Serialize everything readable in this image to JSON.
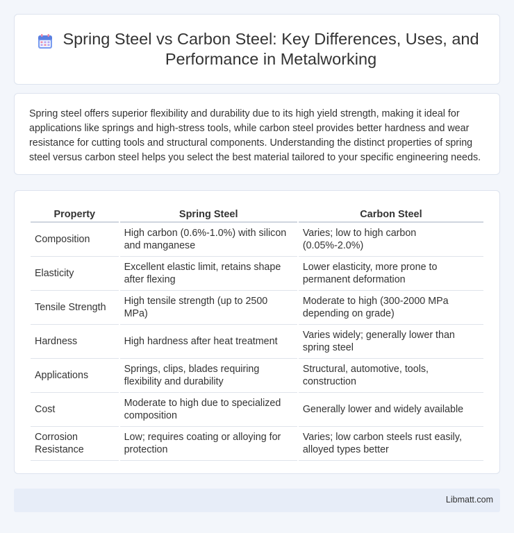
{
  "header": {
    "title": "Spring Steel vs Carbon Steel: Key Differences, Uses, and Performance in Metalworking",
    "icon": "calendar-icon"
  },
  "intro": {
    "text": "Spring steel offers superior flexibility and durability due to its high yield strength, making it ideal for applications like springs and high-stress tools, while carbon steel provides better hardness and wear resistance for cutting tools and structural components. Understanding the distinct properties of spring steel versus carbon steel helps you select the best material tailored to your specific engineering needs."
  },
  "table": {
    "headers": [
      "Property",
      "Spring Steel",
      "Carbon Steel"
    ],
    "rows": [
      [
        "Composition",
        "High carbon (0.6%-1.0%) with silicon and manganese",
        "Varies; low to high carbon (0.05%-2.0%)"
      ],
      [
        "Elasticity",
        "Excellent elastic limit, retains shape after flexing",
        "Lower elasticity, more prone to permanent deformation"
      ],
      [
        "Tensile Strength",
        "High tensile strength (up to 2500 MPa)",
        "Moderate to high (300-2000 MPa depending on grade)"
      ],
      [
        "Hardness",
        "High hardness after heat treatment",
        "Varies widely; generally lower than spring steel"
      ],
      [
        "Applications",
        "Springs, clips, blades requiring flexibility and durability",
        "Structural, automotive, tools, construction"
      ],
      [
        "Cost",
        "Moderate to high due to specialized composition",
        "Generally lower and widely available"
      ],
      [
        "Corrosion Resistance",
        "Low; requires coating or alloying for protection",
        "Varies; low carbon steels rust easily, alloyed types better"
      ]
    ]
  },
  "footer": {
    "text": "Libmatt.com"
  },
  "colors": {
    "background": "#f3f6fb",
    "card": "#ffffff",
    "footer": "#e7edf8",
    "icon_primary": "#6e8fe8",
    "icon_accent": "#f08aa6"
  }
}
